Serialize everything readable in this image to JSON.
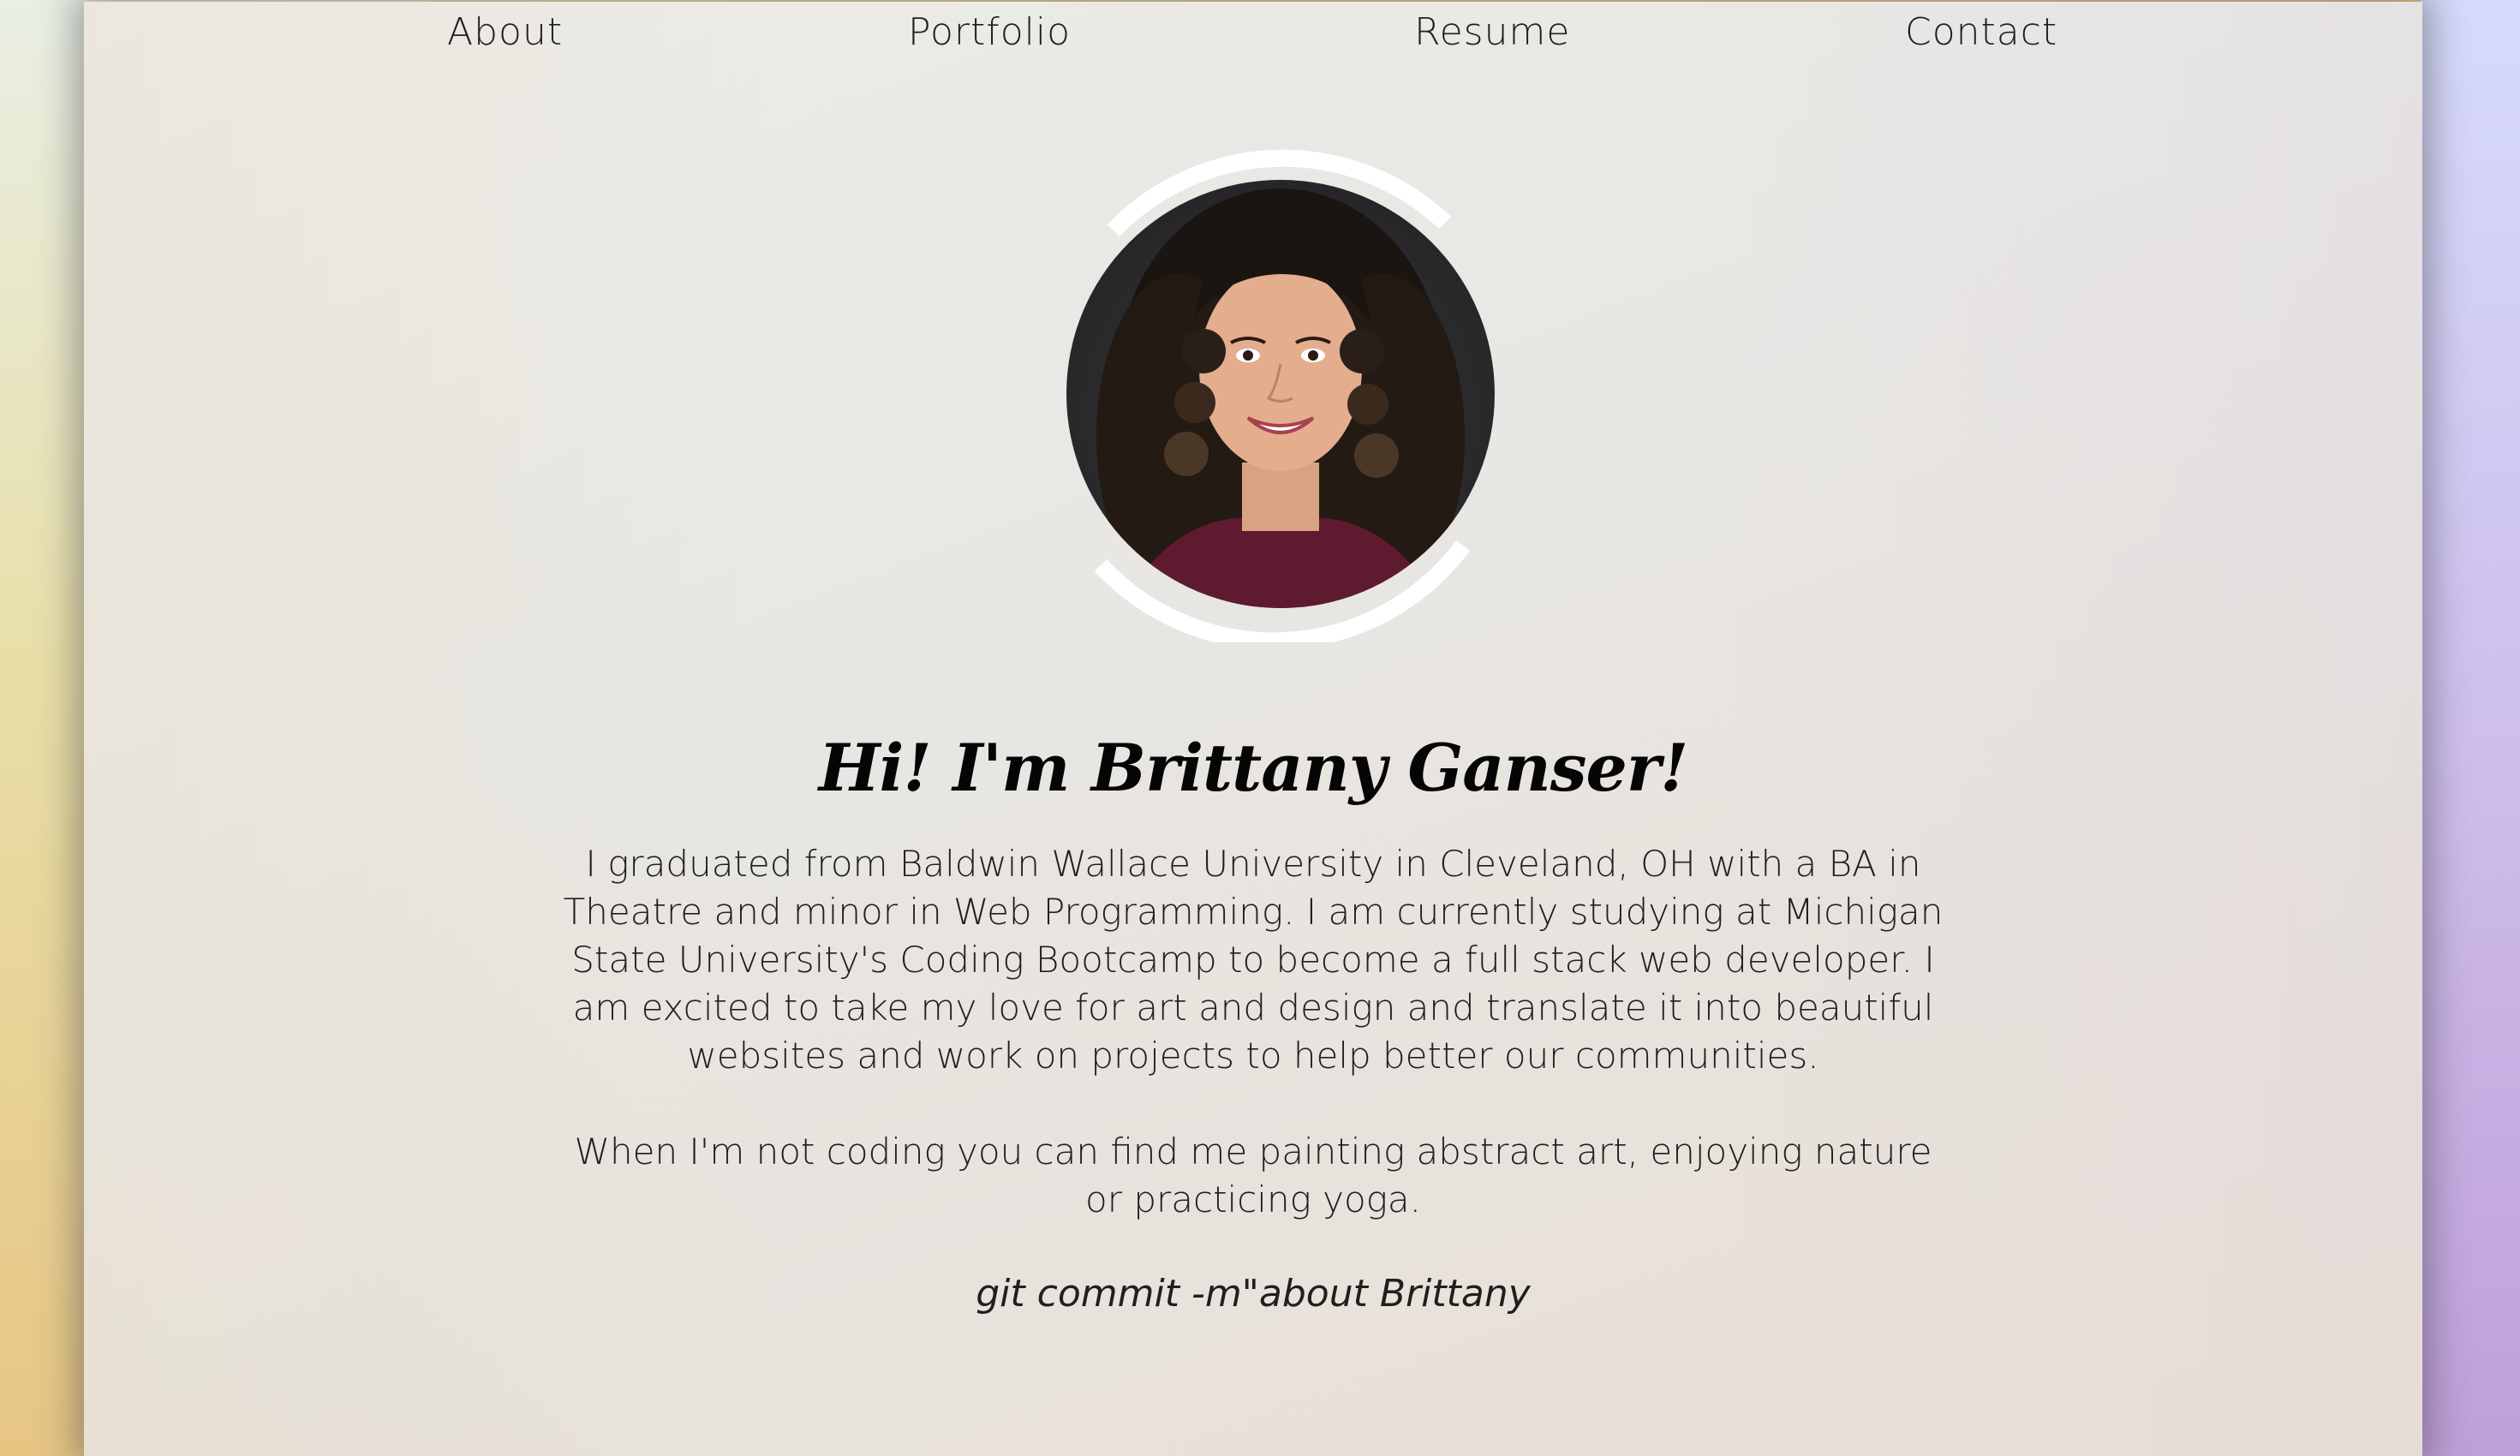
{
  "nav": {
    "items": [
      {
        "label": "About"
      },
      {
        "label": "Portfolio"
      },
      {
        "label": "Resume"
      },
      {
        "label": "Contact"
      }
    ]
  },
  "profile": {
    "heading": "Hi! I'm Brittany Ganser!",
    "bio_paragraph_1": "I graduated from Baldwin Wallace University in Cleveland, OH with a BA in Theatre and minor in Web Programming. I am currently studying at Michigan State University's Coding Bootcamp to become a full stack web developer. I am excited to take my love for art and design and translate it into beautiful websites and work on projects to help better our communities.",
    "bio_paragraph_2": "When I'm not coding you can find me painting abstract art, enjoying nature or practicing yoga.",
    "tagline": "git commit -m\"about Brittany"
  },
  "colors": {
    "panel": "#ebeae6",
    "text": "#1f1f1f",
    "heading": "#050505",
    "ring": "#ffffff",
    "side_left": "#e8c47f",
    "side_right": "#bf9fd8"
  },
  "icons": {
    "avatar": "profile-photo"
  }
}
